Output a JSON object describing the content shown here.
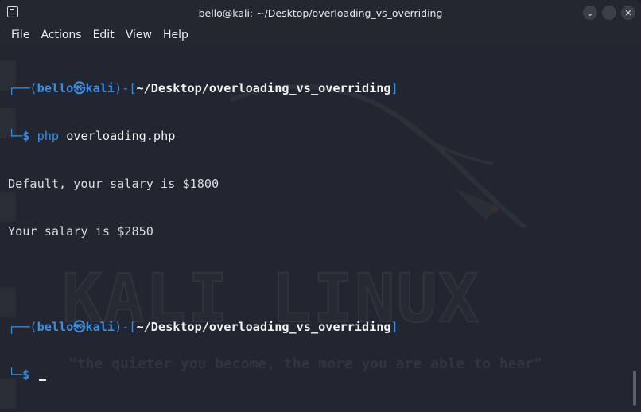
{
  "window": {
    "title": "bello@kali: ~/Desktop/overloading_vs_overriding",
    "minimize_glyph": "⌄",
    "maximize_glyph": "",
    "close_glyph": "✕"
  },
  "menu": [
    "File",
    "Actions",
    "Edit",
    "View",
    "Help"
  ],
  "prompt": {
    "corner_top": "┌──(",
    "user": "bello",
    "skull": "㉿",
    "host": "kali",
    "close_paren": ")-[",
    "path": "~/Desktop/overloading_vs_overriding",
    "close_bracket": "]",
    "corner_bottom": "└─",
    "dollar": "$"
  },
  "session": {
    "command_name": "php",
    "command_arg": "overloading.php",
    "output": [
      "Default, your salary is $1800",
      "Your salary is $2850"
    ]
  },
  "background": {
    "logo": "KALI LINUX",
    "motto": "\"the quieter you become, the more you are able to hear\""
  },
  "colors": {
    "prompt_blue": "#3b8ee0",
    "terminal_bg": "#232630"
  }
}
